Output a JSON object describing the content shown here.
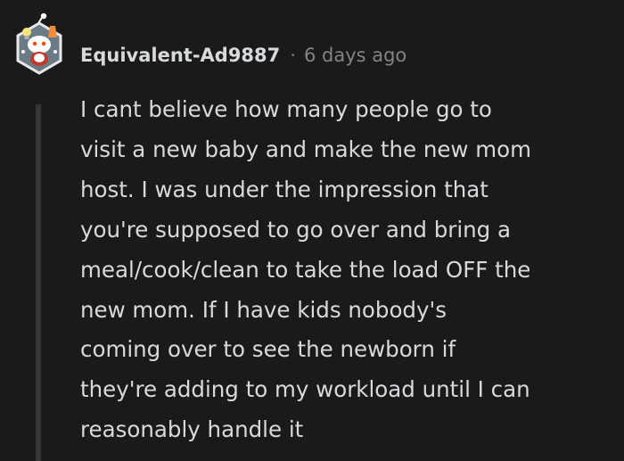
{
  "comment": {
    "author": "Equivalent-Ad9887",
    "separator": "·",
    "timestamp": "6 days ago",
    "avatar_icon": "snoo-avatar-icon",
    "body_lines": [
      "I cant believe how many people go to",
      "visit a new baby and make the new mom",
      "host. I was under the impression that",
      "you're supposed to go over and bring a",
      "meal/cook/clean to take the load OFF the",
      "new mom. If I have kids nobody's",
      "coming over to see the newborn if",
      "they're adding to my workload until I can",
      "reasonably handle it"
    ]
  },
  "colors": {
    "background": "#1a1a1b",
    "text": "#d7dadc",
    "meta": "#818384",
    "thread_line": "#343536"
  }
}
